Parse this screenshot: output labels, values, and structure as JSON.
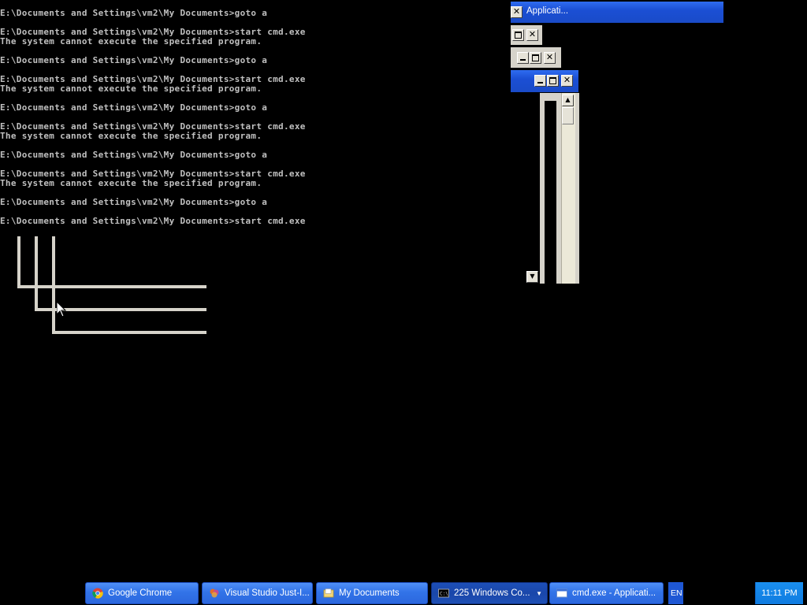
{
  "console": {
    "lines": [
      "E:\\Documents and Settings\\vm2\\My Documents>goto a",
      "",
      "E:\\Documents and Settings\\vm2\\My Documents>start cmd.exe",
      "The system cannot execute the specified program.",
      "",
      "E:\\Documents and Settings\\vm2\\My Documents>goto a",
      "",
      "E:\\Documents and Settings\\vm2\\My Documents>start cmd.exe",
      "The system cannot execute the specified program.",
      "",
      "E:\\Documents and Settings\\vm2\\My Documents>goto a",
      "",
      "E:\\Documents and Settings\\vm2\\My Documents>start cmd.exe",
      "The system cannot execute the specified program.",
      "",
      "E:\\Documents and Settings\\vm2\\My Documents>goto a",
      "",
      "E:\\Documents and Settings\\vm2\\My Documents>start cmd.exe",
      "The system cannot execute the specified program.",
      "",
      "E:\\Documents and Settings\\vm2\\My Documents>goto a",
      "",
      "E:\\Documents and Settings\\vm2\\My Documents>start cmd.exe"
    ]
  },
  "stacked_window": {
    "title": "Applicati...",
    "icons": [
      "close-icon",
      "maximize-icon",
      "minimize-icon",
      "scroll-down-icon",
      "scroll-up-icon"
    ]
  },
  "taskbar": {
    "items": [
      {
        "label": "Google Chrome",
        "icon": "chrome-icon"
      },
      {
        "label": "Visual Studio Just-I...",
        "icon": "visual-studio-icon"
      },
      {
        "label": "My Documents",
        "icon": "folder-icon"
      },
      {
        "label": "225 Windows Co...",
        "icon": "cmd-icon"
      },
      {
        "label": "cmd.exe - Applicati...",
        "icon": "window-icon"
      }
    ],
    "language": "EN",
    "clock": "11:11 PM"
  },
  "colors": {
    "console_text": "#c0c0c0",
    "background": "#000000",
    "taskbar_button": "#3273e8",
    "titlebar": "#1b4fd4"
  }
}
